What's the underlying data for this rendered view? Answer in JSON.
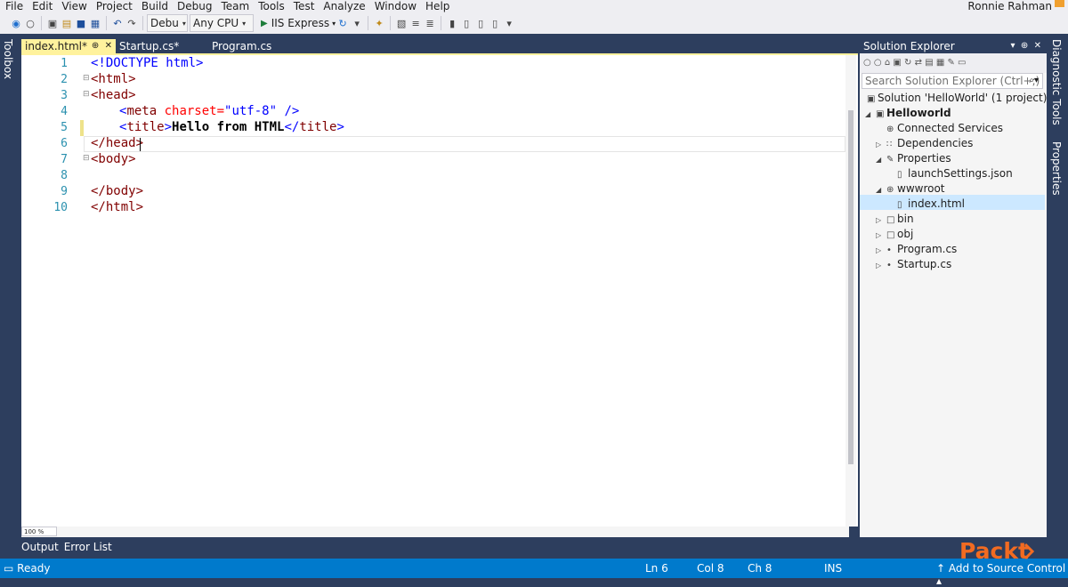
{
  "menu": {
    "items": [
      "File",
      "Edit",
      "View",
      "Project",
      "Build",
      "Debug",
      "Team",
      "Tools",
      "Test",
      "Analyze",
      "Window",
      "Help"
    ]
  },
  "user": {
    "name": "Ronnie Rahman"
  },
  "toolbar": {
    "config": "Debu",
    "platform": "Any CPU",
    "run_target": "IIS Express"
  },
  "left_panel": {
    "label": "Toolbox"
  },
  "right_panel": {
    "labels": [
      "Diagnostic Tools",
      "Properties"
    ]
  },
  "editor": {
    "tabs": [
      {
        "label": "index.html*"
      },
      {
        "label": "Startup.cs*"
      },
      {
        "label": "Program.cs"
      }
    ],
    "line_numbers": [
      "1",
      "2",
      "3",
      "4",
      "5",
      "6",
      "7",
      "8",
      "9",
      "10"
    ],
    "zoom": "100 %"
  },
  "code": {
    "l1_tag": "<!DOCTYPE html>",
    "l2_tag": "<html>",
    "l3_tag": "<head>",
    "l4_open": "<",
    "l4_tag": "meta",
    "l4_attr": " charset=",
    "l4_val": "\"utf-8\"",
    "l4_close": " />",
    "l5_open": "<",
    "l5_tag": "title",
    "l5_gt": ">",
    "l5_text": "Hello from HTML",
    "l5_close_lt": "</",
    "l5_close_tag": "title",
    "l5_close_gt": ">",
    "l6_tag": "</head>",
    "l7_tag": "<body>",
    "l9_tag": "</body>",
    "l10_tag": "</html>"
  },
  "bottom_tabs": [
    "Output",
    "Error List"
  ],
  "status": {
    "ready": "Ready",
    "ln": "Ln 6",
    "col": "Col 8",
    "ch": "Ch 8",
    "ins": "INS",
    "source_control": "Add to Source Control"
  },
  "solution_explorer": {
    "title": "Solution Explorer",
    "search_placeholder": "Search Solution Explorer (Ctrl+;)",
    "tree": [
      "Solution 'HelloWorld' (1 project)",
      "Helloworld",
      "Connected Services",
      "Dependencies",
      "Properties",
      "launchSettings.json",
      "wwwroot",
      "index.html",
      "bin",
      "obj",
      "Program.cs",
      "Startup.cs"
    ]
  },
  "brand": {
    "logo_text": "Packt>"
  }
}
